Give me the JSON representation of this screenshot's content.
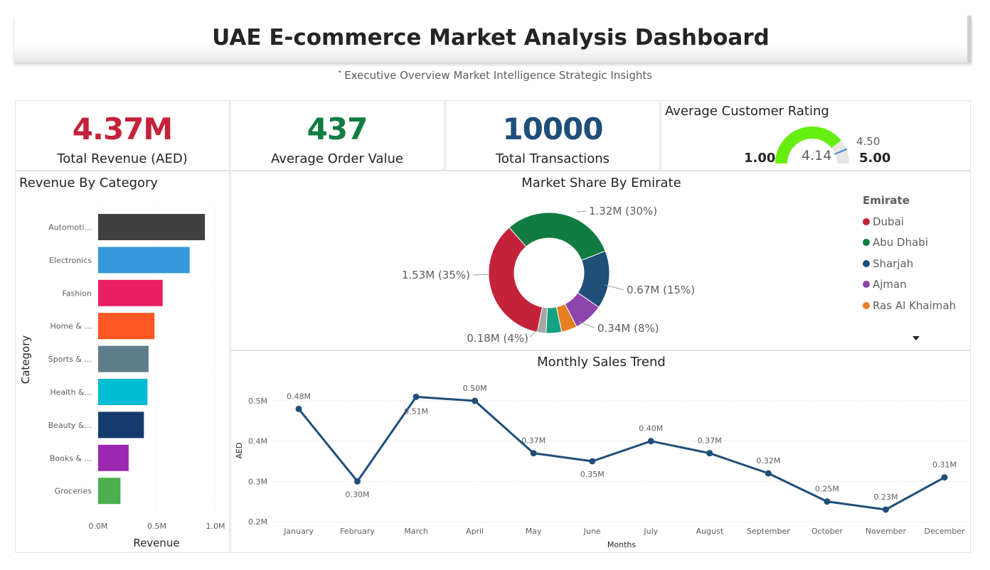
{
  "header": {
    "title": "UAE E-commerce Market Analysis Dashboard",
    "subtitle": "Executive Overview Market Intelligence Strategic Insights"
  },
  "kpis": [
    {
      "value": "4.37M",
      "label": "Total Revenue (AED)",
      "color": "#c4213a"
    },
    {
      "value": "437",
      "label": "Average Order Value",
      "color": "#107c41"
    },
    {
      "value": "10000",
      "label": "Total Transactions",
      "color": "#1f4e79"
    }
  ],
  "gauge": {
    "title": "Average Customer Rating",
    "value": 4.14,
    "value_label": "4.14",
    "min": 1.0,
    "min_label": "1.00",
    "max": 5.0,
    "max_label": "5.00",
    "target": 4.5,
    "target_label": "4.50",
    "fill_color": "#66ee11",
    "track_color": "#e6e6e6",
    "target_color": "#3b86d8"
  },
  "chart_data": [
    {
      "type": "bar",
      "orientation": "horizontal",
      "title": "Revenue By Category",
      "xlabel": "Revenue",
      "ylabel": "Category",
      "categories": [
        "Automoti...",
        "Electronics",
        "Fashion",
        "Home & ...",
        "Sports & ...",
        "Health &...",
        "Beauty &...",
        "Books & ...",
        "Groceries"
      ],
      "values": [
        0.91,
        0.78,
        0.55,
        0.48,
        0.43,
        0.42,
        0.39,
        0.26,
        0.19
      ],
      "colors": [
        "#404040",
        "#3498db",
        "#e91e63",
        "#ff5722",
        "#607d8b",
        "#00bcd4",
        "#163a6b",
        "#9c27b0",
        "#4caf50"
      ],
      "xticks": [
        "0.0M",
        "0.5M",
        "1.0M"
      ],
      "xlim": [
        0,
        1.0
      ],
      "grid": true
    },
    {
      "type": "pie",
      "donut": true,
      "title": "Market Share By Emirate",
      "legend_title": "Emirate",
      "legend_position": "right",
      "slices": [
        {
          "name": "Dubai",
          "value": 1.53,
          "color": "#c4213a"
        },
        {
          "name": "Abu Dhabi",
          "value": 1.32,
          "color": "#107c41"
        },
        {
          "name": "Sharjah",
          "value": 0.67,
          "color": "#1f4e79"
        },
        {
          "name": "Ajman",
          "value": 0.34,
          "color": "#8e44ad"
        },
        {
          "name": "Ras Al Khaimah",
          "value": 0.18,
          "color": "#e67e22"
        },
        {
          "name": "",
          "value": 0.18,
          "color": "#16a085"
        },
        {
          "name": "",
          "value": 0.1,
          "color": "#a6a6a6"
        }
      ],
      "data_labels": [
        "1.32M (30%)",
        "1.53M (35%)",
        "0.67M (15%)",
        "0.34M (8%)",
        "0.18M (4%)"
      ]
    },
    {
      "type": "line",
      "title": "Monthly Sales Trend",
      "xlabel": "Months",
      "ylabel": "AED",
      "x": [
        "January",
        "February",
        "March",
        "April",
        "May",
        "June",
        "July",
        "August",
        "September",
        "October",
        "November",
        "December"
      ],
      "values": [
        0.48,
        0.3,
        0.51,
        0.5,
        0.37,
        0.35,
        0.4,
        0.37,
        0.32,
        0.25,
        0.23,
        0.31
      ],
      "point_labels": [
        "0.48M",
        "0.30M",
        "0.51M",
        "0.50M",
        "0.37M",
        "0.35M",
        "0.40M",
        "0.37M",
        "0.32M",
        "0.25M",
        "0.23M",
        "0.31M"
      ],
      "yticks": [
        "0.2M",
        "0.3M",
        "0.4M",
        "0.5M"
      ],
      "ylim": [
        0.2,
        0.5
      ],
      "color": "#1f4e79",
      "grid": true
    }
  ]
}
